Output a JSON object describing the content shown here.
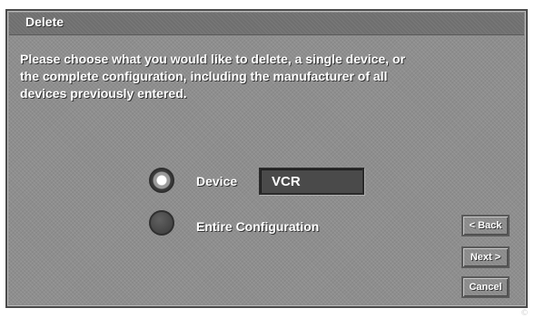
{
  "window": {
    "title": "Delete"
  },
  "instructions": "Please choose what you would like to delete, a single device, or\nthe complete configuration, including the manufacturer of all\ndevices previously entered.",
  "options": {
    "device": {
      "label": "Device",
      "selected": true,
      "value": "VCR"
    },
    "entire": {
      "label": "Entire Configuration",
      "selected": false
    }
  },
  "buttons": {
    "back": "< Back",
    "next": "Next >",
    "cancel": "Cancel"
  },
  "colors": {
    "panel": "#8e8e8e",
    "text": "#ffffff",
    "field": "#4a4a4a"
  },
  "icons": {
    "corner": "copyright-icon"
  }
}
